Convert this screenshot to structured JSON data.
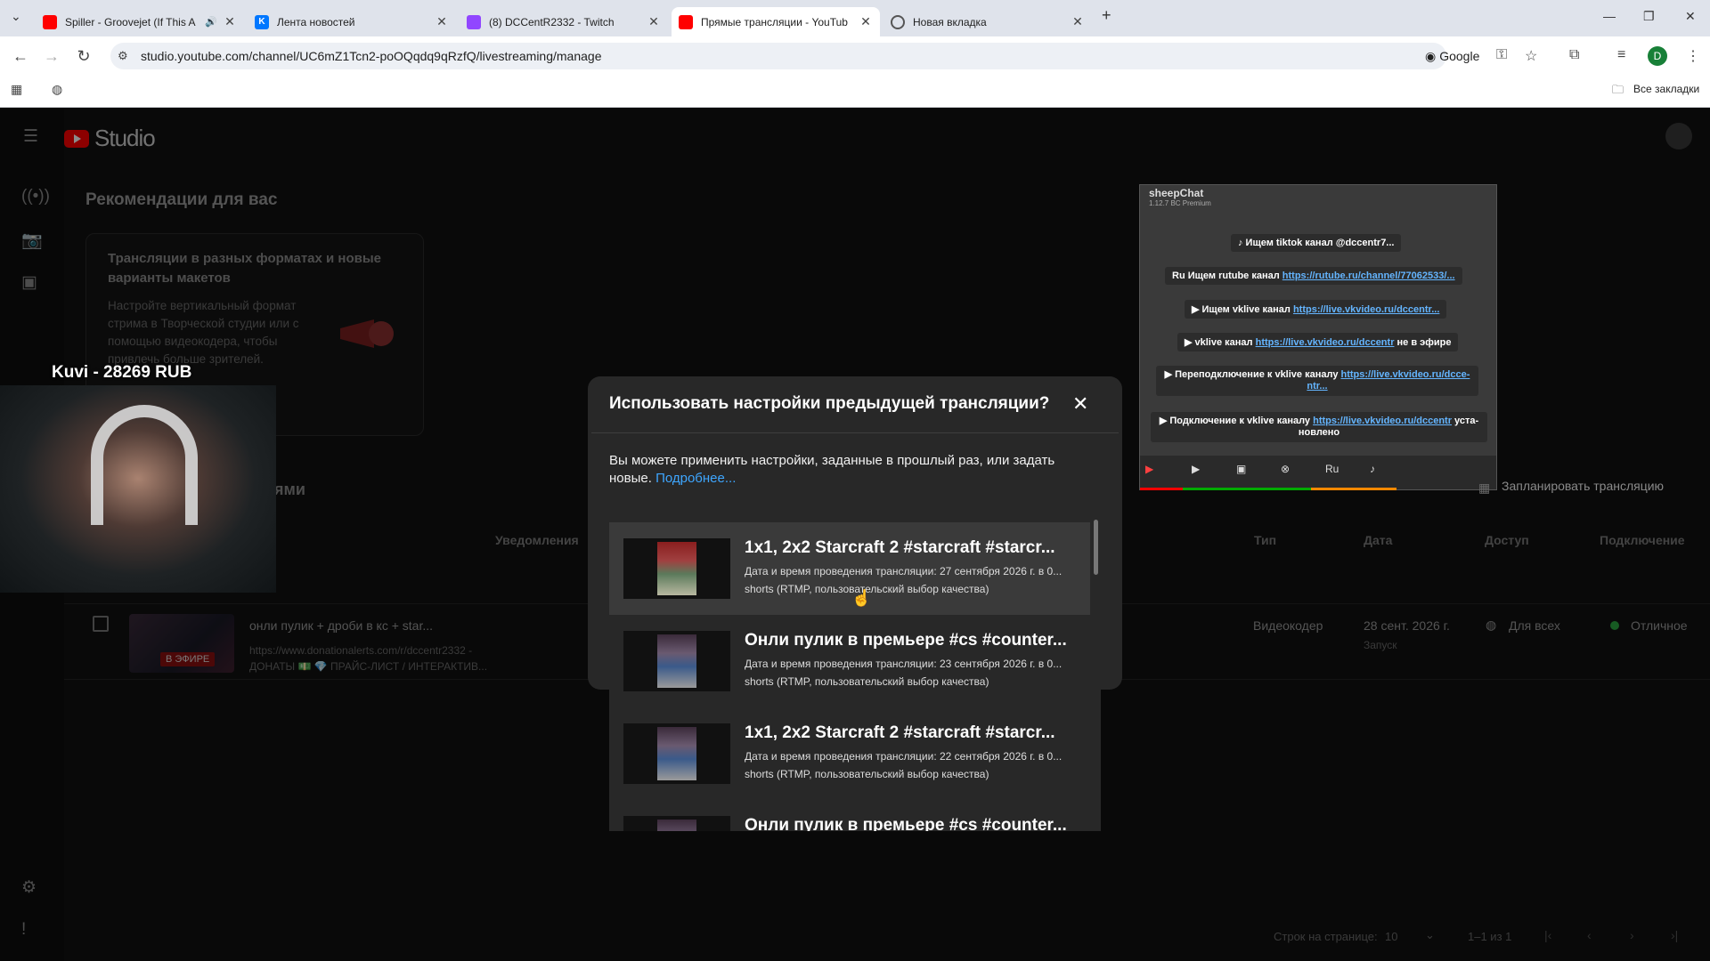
{
  "browser": {
    "tabs": [
      {
        "title": "Spiller - Groovejet (If This A",
        "icon": "youtube-icon",
        "audio": "🔊"
      },
      {
        "title": "Лента новостей",
        "icon": "vk-icon"
      },
      {
        "title": "(8) DCCentR2332 - Twitch",
        "icon": "twitch-icon"
      },
      {
        "title": "Прямые трансляции - YouTub",
        "icon": "youtube-icon",
        "active": true
      },
      {
        "title": "Новая вкладка",
        "icon": "chrome-icon"
      }
    ],
    "url": "studio.youtube.com/channel/UC6mZ1Tcn2-poOQqdq9qRzfQ/livestreaming/manage",
    "google_label": "Google",
    "profile_letter": "D",
    "bookmarks_all": "Все закладки"
  },
  "studio": {
    "logo_text": "Studio",
    "reco_heading": "Рекомендации для вас",
    "card_title": "Трансляции в разных форматах и новые варианты макетов",
    "card_desc": "Настройте вертикальный формат стрима в Творческой студии или с помощью видеокодера, чтобы привлечь больше зрителей.",
    "section_partial": "ями",
    "schedule_button": "Запланировать трансляцию",
    "columns": {
      "notifications": "Уведомления",
      "type": "Тип",
      "date": "Дата",
      "access": "Доступ",
      "connection": "Подключение"
    },
    "row": {
      "title": "онли пулик + дроби в кс + star...",
      "desc1": "https://www.donationalerts.com/r/dccentr2332 -",
      "desc2": "ДОНАТЫ 💵 💎 ПРАЙС-ЛИСТ / ИНТЕРАКТИВ...",
      "live_badge": "В ЭФИРЕ",
      "type": "Видеокодер",
      "date": "28 сент. 2026 г.",
      "date_sub": "Запуск",
      "access": "Для всех",
      "connection": "Отличное"
    },
    "pager": {
      "rows_label": "Строк на странице:",
      "rows_value": "10",
      "range": "1–1 из 1"
    }
  },
  "overlay": {
    "donation": "Kuvi - 28269 RUB",
    "chat_title": "sheepChat",
    "chat_subtitle": "1.12.7 BC Premium",
    "messages": [
      {
        "prefix": "♪ Ищем tiktok канал @dccentr7...",
        "link": ""
      },
      {
        "prefix": "Ru Ищем rutube канал ",
        "link": "https://rutube.ru/channel/77062533/..."
      },
      {
        "prefix": "▶ Ищем vklive канал ",
        "link": "https://live.vkvideo.ru/dccentr..."
      },
      {
        "prefix": "▶ vklive канал ",
        "link": "https://live.vkvideo.ru/dccentr",
        "suffix": " не в эфире"
      },
      {
        "prefix": "▶ Переподключение к vklive каналу ",
        "link": "https://live.vkvideo.ru/dcce-ntr..."
      },
      {
        "prefix": "▶ Подключение к vklive каналу ",
        "link": "https://live.vkvideo.ru/dccentr",
        "suffix": " уста-новлено"
      }
    ]
  },
  "modal": {
    "title": "Использовать настройки предыдущей трансляции?",
    "text": "Вы можете применить настройки, заданные в прошлый раз, или задать новые.",
    "more_link": "Подробнее...",
    "items": [
      {
        "title": "1x1, 2x2 Starcraft 2 #starcraft #starcr...",
        "date": "Дата и время проведения трансляции: 27 сентября 2026 г. в 0...",
        "format": "shorts (RTMP, пользовательский выбор качества)"
      },
      {
        "title": "Онли пулик в премьере #cs #counter...",
        "date": "Дата и время проведения трансляции: 23 сентября 2026 г. в 0...",
        "format": "shorts (RTMP, пользовательский выбор качества)"
      },
      {
        "title": "1x1, 2x2 Starcraft 2 #starcraft #starcr...",
        "date": "Дата и время проведения трансляции: 22 сентября 2026 г. в 0...",
        "format": "shorts (RTMP, пользовательский выбор качества)"
      },
      {
        "title": "Онли пулик в премьере #cs #counter...",
        "date": "",
        "format": ""
      }
    ]
  }
}
